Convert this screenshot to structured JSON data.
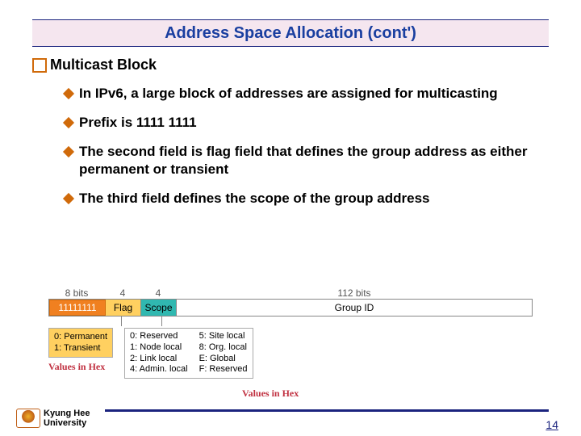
{
  "title": "Address Space Allocation (cont')",
  "section": "Multicast Block",
  "bullets": {
    "b1": "In IPv6, a large block of addresses are assigned for multicasting",
    "b2": "Prefix is 1111 1111",
    "b3": "The second field is flag field that defines the group address as either permanent or transient",
    "b4": "The third field defines the scope of the group address"
  },
  "diagram": {
    "bits8": "8 bits",
    "bits4a": "4",
    "bits4b": "4",
    "bits112": "112 bits",
    "prefix": "11111111",
    "flag": "Flag",
    "scope": "Scope",
    "gid": "Group ID",
    "flagbox": "0: Permanent\n1: Transient",
    "scope_col1": "0: Reserved\n1: Node local\n2: Link local\n4: Admin. local",
    "scope_col2": "5: Site local\n8: Org. local\nE: Global\nF: Reserved",
    "vh": "Values in Hex"
  },
  "footer": {
    "uni1": "Kyung Hee",
    "uni2": "University",
    "page": "14"
  }
}
